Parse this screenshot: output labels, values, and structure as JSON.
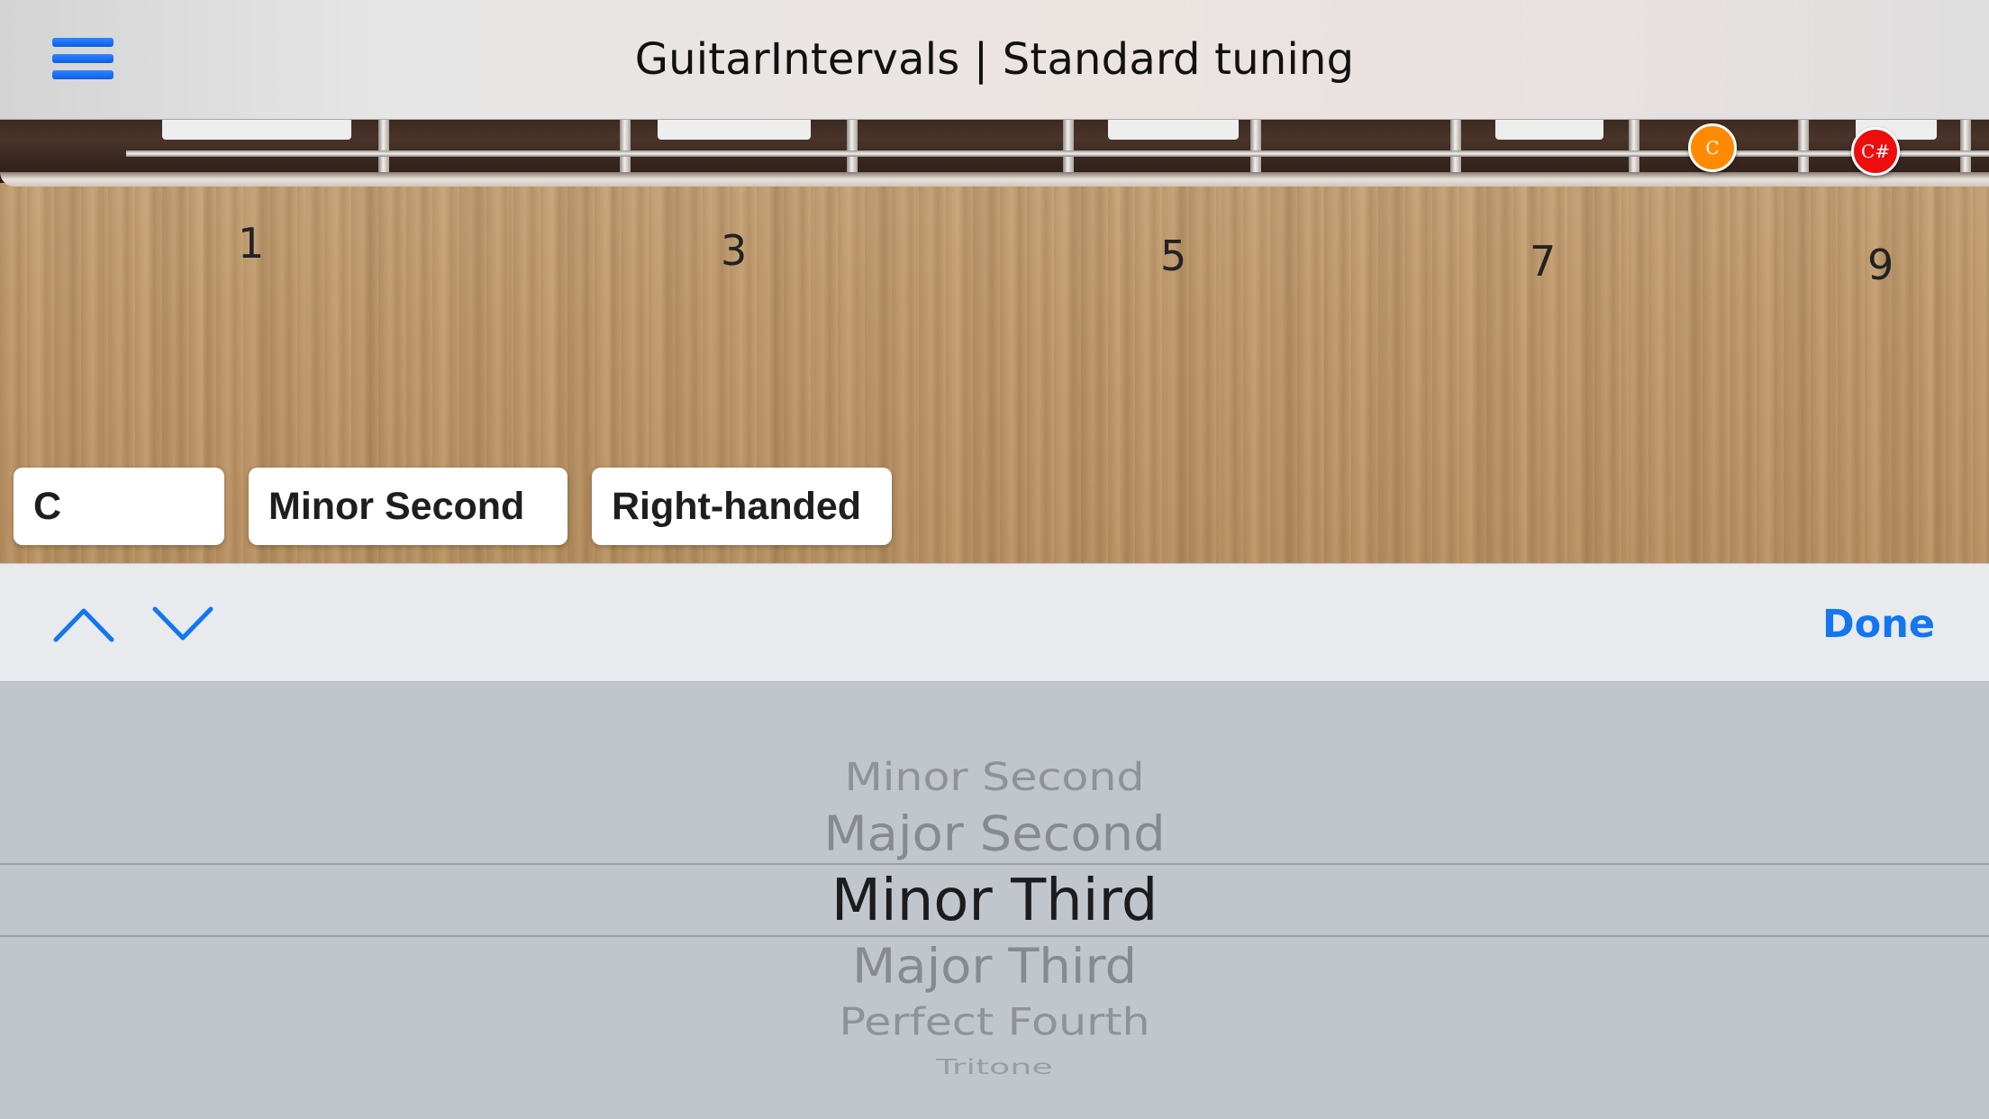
{
  "navbar": {
    "menu_icon": "hamburger-menu-icon",
    "title": "GuitarIntervals | Standard tuning"
  },
  "fretboard": {
    "fret_numbers": [
      "1",
      "3",
      "5",
      "7",
      "9"
    ],
    "notes": [
      {
        "label": "C",
        "color": "#ff8a00"
      },
      {
        "label": "C#",
        "color": "#ee0d0d"
      }
    ]
  },
  "selectors": {
    "root_note": "C",
    "interval": "Minor Second",
    "handedness": "Right-handed"
  },
  "toolbar": {
    "previous_icon": "chevron-up-icon",
    "next_icon": "chevron-down-icon",
    "done_label": "Done",
    "accent_color": "#1476ee"
  },
  "picker": {
    "selected": "Minor Third",
    "items": [
      "Minor Second",
      "Major Second",
      "Minor Third",
      "Major Third",
      "Perfect Fourth",
      "Tritone"
    ]
  }
}
